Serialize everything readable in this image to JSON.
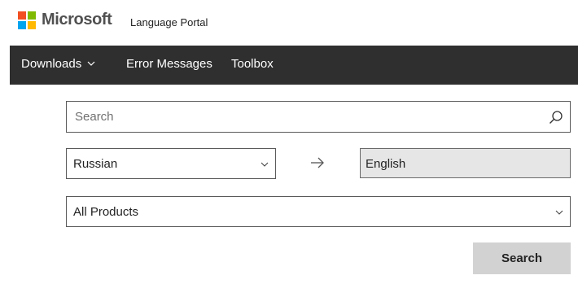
{
  "header": {
    "brand": "Microsoft",
    "portal_title": "Language Portal",
    "logo_colors": [
      "#f25022",
      "#7fba00",
      "#00a4ef",
      "#ffb900"
    ]
  },
  "nav": {
    "background": "#2f2f2f",
    "items": [
      {
        "label": "Downloads",
        "icon": "chevron-down-icon"
      },
      {
        "label": "Error Messages"
      },
      {
        "label": "Toolbox"
      }
    ]
  },
  "search": {
    "placeholder": "Search",
    "value": "",
    "icon": "search-icon"
  },
  "translation": {
    "source_language": "Russian",
    "arrow_icon": "arrow-right-icon",
    "target_language": "English",
    "product": "All Products"
  },
  "actions": {
    "search_button": "Search"
  }
}
